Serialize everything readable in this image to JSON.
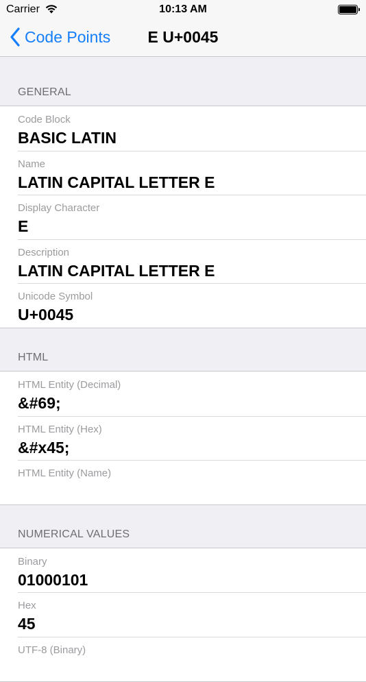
{
  "status_bar": {
    "carrier": "Carrier",
    "time": "10:13 AM"
  },
  "nav": {
    "back_label": "Code Points",
    "title": "E U+0045"
  },
  "sections": [
    {
      "header": "GENERAL",
      "rows": [
        {
          "label": "Code Block",
          "value": "BASIC LATIN"
        },
        {
          "label": "Name",
          "value": "LATIN CAPITAL LETTER E"
        },
        {
          "label": "Display Character",
          "value": "E"
        },
        {
          "label": "Description",
          "value": "LATIN CAPITAL LETTER E"
        },
        {
          "label": "Unicode Symbol",
          "value": "U+0045"
        }
      ]
    },
    {
      "header": "HTML",
      "rows": [
        {
          "label": "HTML Entity (Decimal)",
          "value": "&#69;"
        },
        {
          "label": "HTML Entity (Hex)",
          "value": "&#x45;"
        },
        {
          "label": "HTML Entity (Name)",
          "value": ""
        }
      ]
    },
    {
      "header": "NUMERICAL VALUES",
      "rows": [
        {
          "label": "Binary",
          "value": "01000101"
        },
        {
          "label": "Hex",
          "value": "45"
        },
        {
          "label": "UTF-8 (Binary)",
          "value": ""
        }
      ]
    }
  ],
  "colors": {
    "accent": "#147efb",
    "background": "#efeff4"
  },
  "icons": {
    "wifi": "wifi-icon",
    "battery": "battery-icon",
    "back": "chevron-left-icon"
  }
}
